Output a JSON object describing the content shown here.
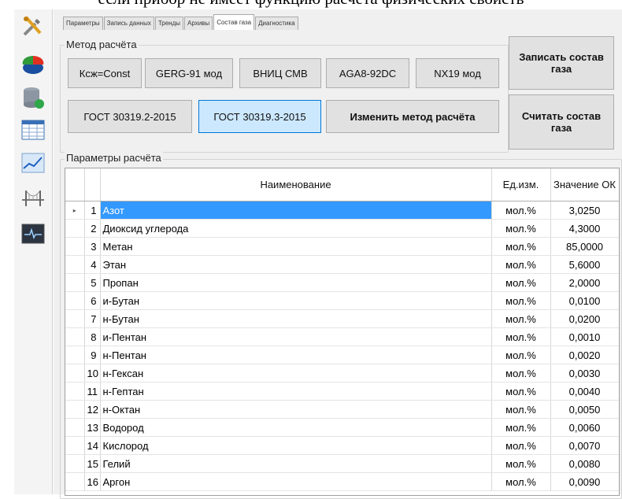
{
  "document_text": "если прибор не имеет функцию расчёта физических свойств",
  "tabs": [
    "Параметры",
    "Запись данных",
    "Тренды",
    "Архивы",
    "Состав газа",
    "Диагностика"
  ],
  "active_tab": "Состав газа",
  "method_group": {
    "title": "Метод расчёта",
    "methods_row1": [
      "Ксж=Const",
      "GERG-91 мод",
      "ВНИЦ СМВ",
      "AGA8-92DC",
      "NX19 мод"
    ],
    "methods_row2": [
      "ГОСТ 30319.2-2015",
      "ГОСТ 30319.3-2015"
    ],
    "selected_method": "ГОСТ 30319.3-2015",
    "change_button": "Изменить метод расчёта"
  },
  "actions": {
    "write_composition": "Записать состав газа",
    "read_composition": "Считать состав газа"
  },
  "params_group": {
    "title": "Параметры расчёта"
  },
  "table": {
    "columns": {
      "name": "Наименование",
      "unit": "Ед.изм.",
      "value": "Значение ОК"
    },
    "row_marker": "▸",
    "rows": [
      {
        "n": "1",
        "name": "Азот",
        "unit": "мол.%",
        "value": "3,0250"
      },
      {
        "n": "2",
        "name": "Диоксид углерода",
        "unit": "мол.%",
        "value": "4,3000"
      },
      {
        "n": "3",
        "name": "Метан",
        "unit": "мол.%",
        "value": "85,0000"
      },
      {
        "n": "4",
        "name": "Этан",
        "unit": "мол.%",
        "value": "5,6000"
      },
      {
        "n": "5",
        "name": "Пропан",
        "unit": "мол.%",
        "value": "2,0000"
      },
      {
        "n": "6",
        "name": "и-Бутан",
        "unit": "мол.%",
        "value": "0,0100"
      },
      {
        "n": "7",
        "name": "н-Бутан",
        "unit": "мол.%",
        "value": "0,0200"
      },
      {
        "n": "8",
        "name": "и-Пентан",
        "unit": "мол.%",
        "value": "0,0010"
      },
      {
        "n": "9",
        "name": "н-Пентан",
        "unit": "мол.%",
        "value": "0,0020"
      },
      {
        "n": "10",
        "name": "н-Гексан",
        "unit": "мол.%",
        "value": "0,0030"
      },
      {
        "n": "11",
        "name": "н-Гептан",
        "unit": "мол.%",
        "value": "0,0040"
      },
      {
        "n": "12",
        "name": "н-Октан",
        "unit": "мол.%",
        "value": "0,0050"
      },
      {
        "n": "13",
        "name": "Водород",
        "unit": "мол.%",
        "value": "0,0060"
      },
      {
        "n": "14",
        "name": "Кислород",
        "unit": "мол.%",
        "value": "0,0070"
      },
      {
        "n": "15",
        "name": "Гелий",
        "unit": "мол.%",
        "value": "0,0080"
      },
      {
        "n": "16",
        "name": "Аргон",
        "unit": "мол.%",
        "value": "0,0090"
      }
    ],
    "selected_row": 0
  },
  "sidebar_icons": [
    "tools-icon",
    "pie-chart-icon",
    "database-icon",
    "table-icon",
    "trend-chart-icon",
    "bridge-icon",
    "monitor-icon"
  ],
  "colors": {
    "selection": "#3399ff",
    "active_button": "#cce8ff",
    "active_border": "#0078d7"
  }
}
